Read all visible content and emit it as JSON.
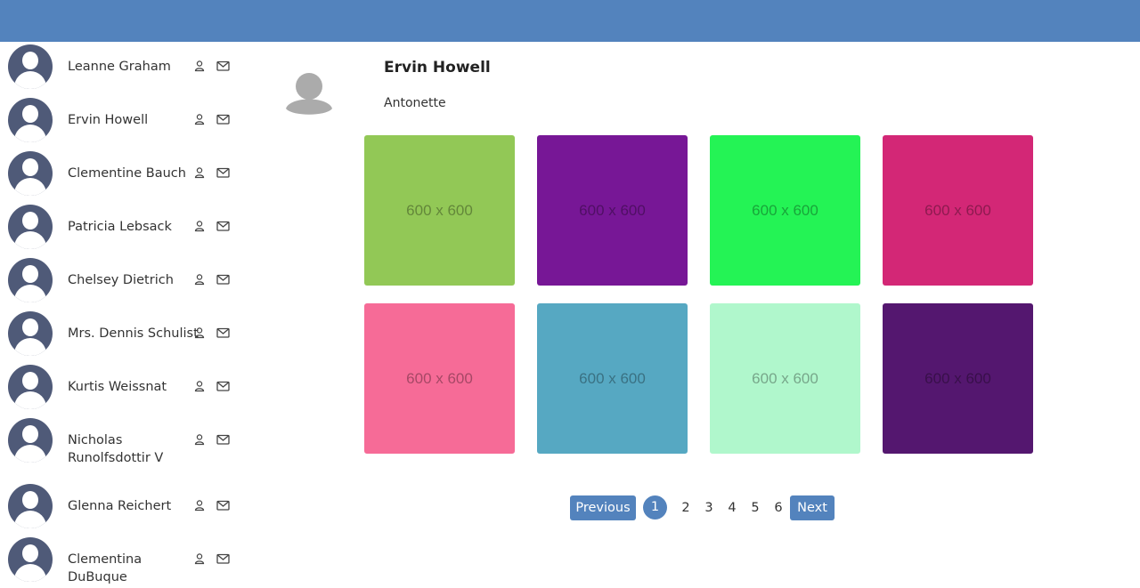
{
  "colors": {
    "topbar": "#5383bd",
    "accent": "#5383bd",
    "avatar": "#4f5a78"
  },
  "users": [
    {
      "name": "Leanne Graham"
    },
    {
      "name": "Ervin Howell"
    },
    {
      "name": "Clementine Bauch"
    },
    {
      "name": "Patricia Lebsack"
    },
    {
      "name": "Chelsey Dietrich"
    },
    {
      "name": "Mrs. Dennis Schulist"
    },
    {
      "name": "Kurtis Weissnat"
    },
    {
      "name": "Nicholas Runolfsdottir V"
    },
    {
      "name": "Glenna Reichert"
    },
    {
      "name": "Clementina DuBuque"
    }
  ],
  "user_icons": [
    "person-icon",
    "mail-icon"
  ],
  "profile": {
    "name": "Ervin Howell",
    "username": "Antonette"
  },
  "photos": [
    {
      "label": "600 x 600",
      "color": "#92c856"
    },
    {
      "label": "600 x 600",
      "color": "#771796"
    },
    {
      "label": "600 x 600",
      "color": "#24f355"
    },
    {
      "label": "600 x 600",
      "color": "#d32776"
    },
    {
      "label": "600 x 600",
      "color": "#f66b97"
    },
    {
      "label": "600 x 600",
      "color": "#56a8c2"
    },
    {
      "label": "600 x 600",
      "color": "#b0f7cc"
    },
    {
      "label": "600 x 600",
      "color": "#54176f"
    }
  ],
  "pagination": {
    "previous_label": "Previous",
    "next_label": "Next",
    "pages": [
      "1",
      "2",
      "3",
      "4",
      "5",
      "6"
    ],
    "current": "1"
  }
}
